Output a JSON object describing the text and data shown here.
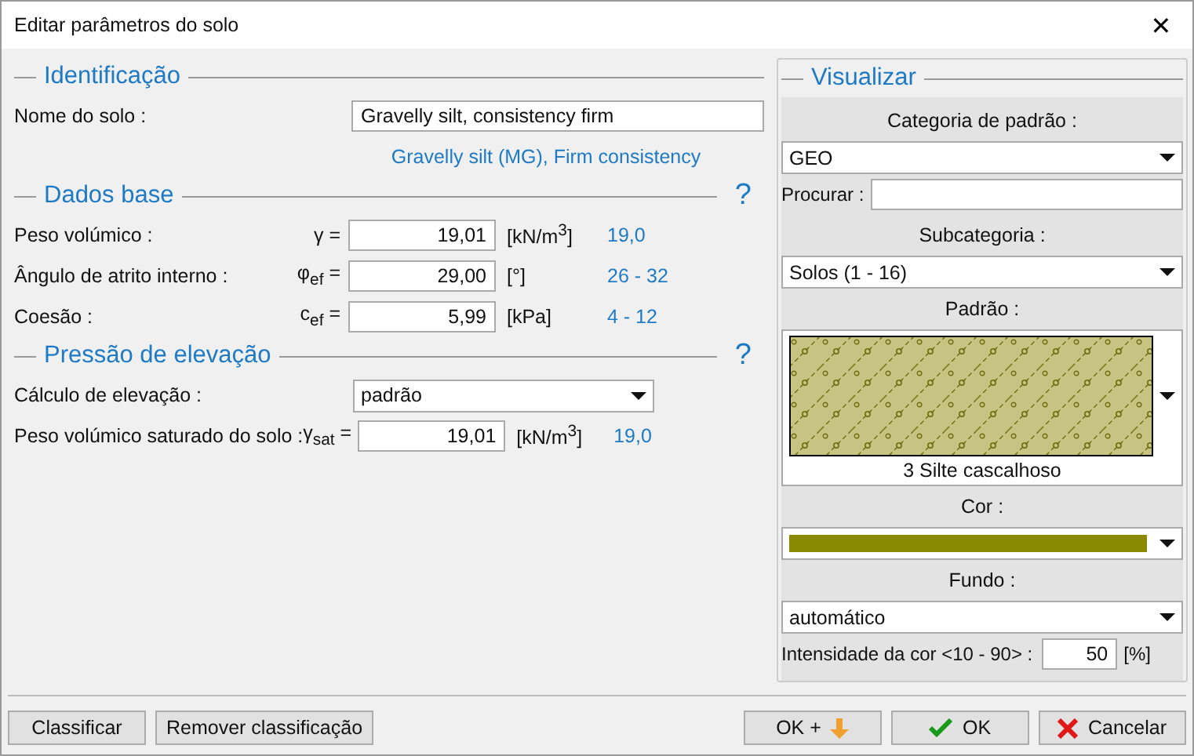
{
  "window": {
    "title": "Editar parâmetros do solo",
    "close": "✕"
  },
  "identificacao": {
    "heading": "Identificação",
    "name_label": "Nome do solo :",
    "name_value": "Gravelly silt, consistency firm",
    "note": "Gravelly silt (MG), Firm consistency"
  },
  "dados_base": {
    "heading": "Dados base",
    "help": "?",
    "rows": [
      {
        "label": "Peso volúmico  :",
        "symbol": "γ =",
        "value": "19,01",
        "unit": "[kN/m$^{3}$]",
        "hint": "19,0"
      },
      {
        "label": "Ângulo de atrito interno :",
        "symbol": "φ$_{ef}$ =",
        "value": "29,00",
        "unit": "[°]",
        "hint": "26 - 32"
      },
      {
        "label": "Coesão :",
        "symbol": "c$_{ef}$ =",
        "value": "5,99",
        "unit": "[kPa]",
        "hint": "4 - 12"
      }
    ]
  },
  "pressao": {
    "heading": "Pressão de elevação",
    "help": "?",
    "select_label": "Cálculo de elevação :",
    "select_value": "padrão",
    "rows": [
      {
        "label": "Peso volúmico saturado do solo :",
        "symbol": "γ$_{sat}$ =",
        "value": "19,01",
        "unit": "[kN/m$^{3}$]",
        "hint": "19,0"
      }
    ]
  },
  "visualizar": {
    "heading": "Visualizar",
    "categoria_label": "Categoria de padrão :",
    "categoria_value": "GEO",
    "procurar_label": "Procurar :",
    "subcategoria_label": "Subcategoria :",
    "subcategoria_value": "Solos (1 - 16)",
    "padrao_label": "Padrão :",
    "padrao_name": "3 Silte cascalhoso",
    "cor_label": "Cor :",
    "color": "#8a8a00",
    "fundo_label": "Fundo :",
    "fundo_value": "automático",
    "intensidade_label": "Intensidade da cor <10 - 90> :",
    "intensidade_value": "50",
    "intensidade_unit": "[%]"
  },
  "footer": {
    "left_buttons": [
      "Classificar",
      "Remover classificação"
    ],
    "right_buttons": [
      {
        "kind": "ok-plus",
        "label": "OK +"
      },
      {
        "kind": "ok",
        "label": "OK"
      },
      {
        "kind": "cancel",
        "label": "Cancelar"
      }
    ]
  }
}
